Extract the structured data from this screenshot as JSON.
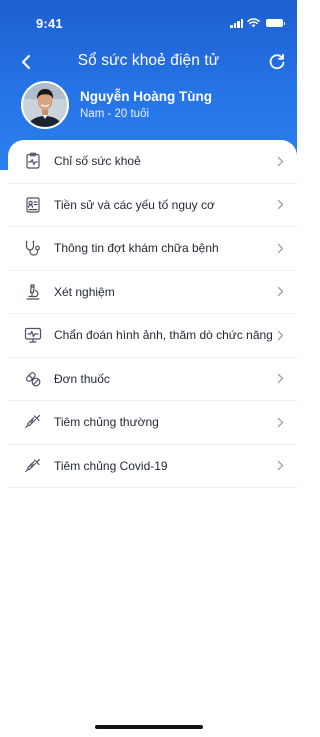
{
  "status_bar": {
    "time": "9:41"
  },
  "nav": {
    "title": "Sổ sức khoẻ điện tử"
  },
  "profile": {
    "name": "Nguyễn Hoàng Tùng",
    "subtitle": "Nam - 20 tuổi"
  },
  "menu": {
    "items": [
      {
        "label": "Chỉ số sức khoẻ",
        "icon": "clipboard-pulse-icon"
      },
      {
        "label": "Tiền sử và các yếu tố nguy cơ",
        "icon": "history-form-icon"
      },
      {
        "label": "Thông tin đợt khám chữa bệnh",
        "icon": "stethoscope-icon"
      },
      {
        "label": "Xét nghiệm",
        "icon": "microscope-icon"
      },
      {
        "label": "Chẩn đoán hình ảnh, thăm dò chức năng",
        "icon": "monitor-wave-icon"
      },
      {
        "label": "Đơn thuốc",
        "icon": "pills-icon"
      },
      {
        "label": "Tiêm chủng thường",
        "icon": "syringe-icon"
      },
      {
        "label": "Tiêm chủng Covid-19",
        "icon": "syringe-icon"
      }
    ]
  },
  "colors": {
    "header_top": "#1e5fcf",
    "header_bottom": "#2b80ee",
    "icon_stroke": "#4a5260",
    "chevron": "#9aa1ab",
    "divider": "#eceef2"
  }
}
